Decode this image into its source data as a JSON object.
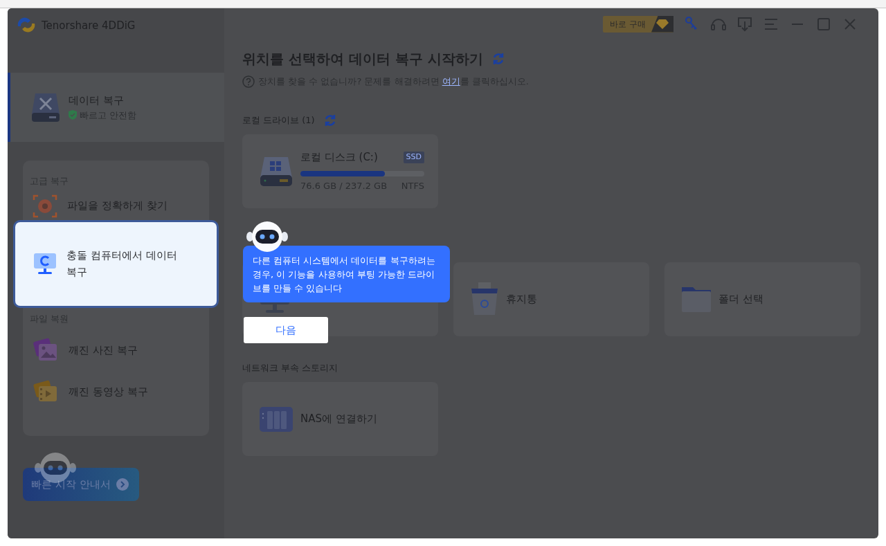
{
  "window": {
    "title": "Tenorshare 4DDiG"
  },
  "toolbar": {
    "buy_label": "바로 구매"
  },
  "sidebar": {
    "primary": {
      "title": "데이터 복구",
      "subtitle": "빠르고 안전함",
      "selected": true
    },
    "groups": [
      {
        "heading": "고급 복구",
        "items": [
          {
            "label": "파일을 정확하게 찾기",
            "kind": "target",
            "highlighted": false
          },
          {
            "label": "충돌 컴퓨터에서 데이터 복구",
            "kind": "monitor",
            "highlighted": true
          }
        ]
      },
      {
        "heading": "파일 복원",
        "items": [
          {
            "label": "깨진 사진 복구",
            "kind": "photo",
            "highlighted": false
          },
          {
            "label": "깨진 동영상 복구",
            "kind": "video",
            "highlighted": false
          }
        ]
      }
    ],
    "quick_start": "빠른 시작 안내서"
  },
  "main": {
    "title": "위치를 선택하여 데이터 복구 시작하기",
    "help": {
      "before": "장치를 찾을 수 없습니까? 문제를 해결하려면 ",
      "link": "여기",
      "after": "를 클릭하십시오."
    },
    "sections": [
      {
        "heading": "로컬 드라이브 (1)",
        "refresh": true,
        "items": [
          {
            "kind": "drive",
            "label": "로컬 디스크 (C:)",
            "tag": "SSD",
            "usage": "76.6 GB / 237.2 GB",
            "filesystem": "NTFS",
            "level": 0.68
          }
        ]
      },
      {
        "items": [
          {
            "kind": "computer"
          },
          {
            "kind": "trash",
            "label": "휴지통"
          },
          {
            "kind": "folder",
            "label": "폴더 선택"
          }
        ]
      },
      {
        "heading": "네트워크 부속 스토리지",
        "refresh": false,
        "items": [
          {
            "kind": "nas",
            "label": "NAS에 연결하기"
          }
        ]
      }
    ]
  },
  "tour": {
    "text": "다른 컴퓨터 시스템에서 데이터를 복구하려는 경우, 이 기능을 사용하여 부팅 가능한 드라이브를 만들 수 있습니다",
    "next": "다음"
  }
}
